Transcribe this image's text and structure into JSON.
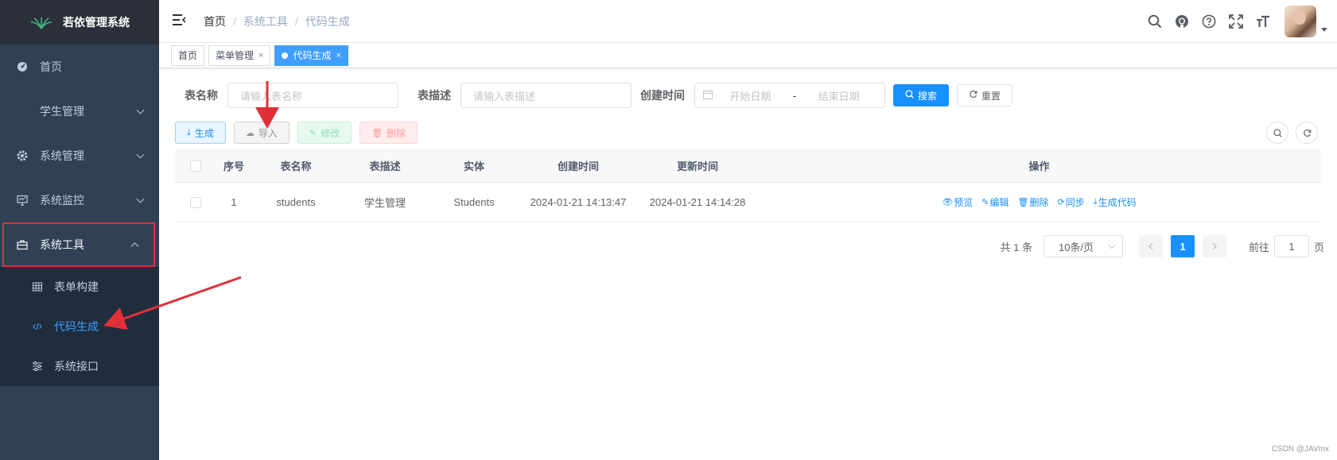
{
  "app": {
    "title": "若依管理系统"
  },
  "sidebar": {
    "items": [
      {
        "label": "首页",
        "icon": "dashboard-icon"
      },
      {
        "label": "学生管理",
        "icon": ""
      },
      {
        "label": "系统管理",
        "icon": "gear-icon"
      },
      {
        "label": "系统监控",
        "icon": "monitor-icon"
      },
      {
        "label": "系统工具",
        "icon": "toolbox-icon"
      }
    ],
    "subitems": [
      {
        "label": "表单构建",
        "icon": "table-icon"
      },
      {
        "label": "代码生成",
        "icon": "code-icon"
      },
      {
        "label": "系统接口",
        "icon": "sliders-icon"
      }
    ]
  },
  "navbar": {
    "breadcrumb": [
      "首页",
      "系统工具",
      "代码生成"
    ],
    "breadcrumb_sep": "/"
  },
  "tags": [
    {
      "label": "首页"
    },
    {
      "label": "菜单管理",
      "close": "×"
    },
    {
      "label": "代码生成",
      "close": "×"
    }
  ],
  "filter": {
    "table_name_label": "表名称",
    "table_name_placeholder": "请输入表名称",
    "table_desc_label": "表描述",
    "table_desc_placeholder": "请输入表描述",
    "create_time_label": "创建时间",
    "start_placeholder": "开始日期",
    "range_sep": "-",
    "end_placeholder": "结束日期",
    "search_label": "搜索",
    "reset_label": "重置"
  },
  "toolbar": {
    "generate_label": "生成",
    "import_label": "导入",
    "edit_label": "修改",
    "delete_label": "删除"
  },
  "table": {
    "headers": [
      "序号",
      "表名称",
      "表描述",
      "实体",
      "创建时间",
      "更新时间",
      "操作"
    ],
    "rows": [
      {
        "no": "1",
        "name": "students",
        "desc": "学生管理",
        "entity": "Students",
        "create_time": "2024-01-21 14:13:47",
        "update_time": "2024-01-21 14:14:28"
      }
    ],
    "ops": [
      "预览",
      "编辑",
      "删除",
      "同步",
      "生成代码"
    ]
  },
  "pagination": {
    "total": "共 1 条",
    "page_size": "10条/页",
    "current": "1",
    "goto_label": "前往",
    "goto_value": "1",
    "page_suffix": "页"
  },
  "watermark": "CSDN @JAVmx",
  "colors": {
    "sidebar_bg": "#304156",
    "submenu_bg": "#1f2d3d",
    "primary": "#1890ff",
    "annotation_red": "#e0303a"
  }
}
